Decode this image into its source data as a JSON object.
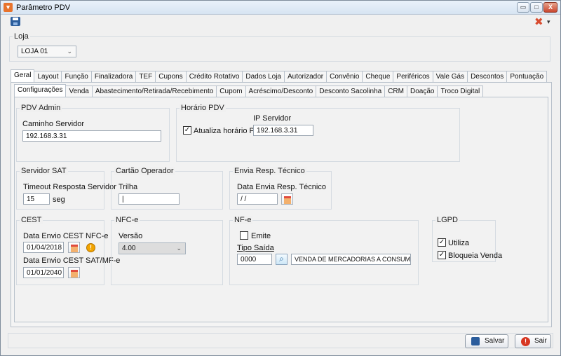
{
  "window": {
    "title": "Parâmetro PDV",
    "minimize": "▭",
    "restore": "□",
    "close": "X"
  },
  "toolbar": {
    "tools_arrow": "▾"
  },
  "loja": {
    "legend": "Loja",
    "selected": "LOJA 01",
    "arrow": "⌄"
  },
  "main_tabs": [
    "Geral",
    "Layout",
    "Função",
    "Finalizadora",
    "TEF",
    "Cupons",
    "Crédito Rotativo",
    "Dados Loja",
    "Autorizador",
    "Convênio",
    "Cheque",
    "Periféricos",
    "Vale Gás",
    "Descontos",
    "Pontuação"
  ],
  "sub_tabs": [
    "Configurações",
    "Venda",
    "Abastecimento/Retirada/Recebimento",
    "Cupom",
    "Acréscimo/Desconto",
    "Desconto Sacolinha",
    "CRM",
    "Doação",
    "Troco Digital"
  ],
  "pdv_admin": {
    "legend": "PDV Admin",
    "label": "Caminho Servidor",
    "value": "192.168.3.31"
  },
  "horario_pdv": {
    "legend": "Horário PDV",
    "ip_label": "IP Servidor",
    "checkbox_label": "Atualiza horário PDV",
    "checked_mark": "✓",
    "ip_value": "192.168.3.31"
  },
  "servidor_sat": {
    "legend": "Servidor SAT",
    "label": "Timeout Resposta Servidor",
    "value": "15",
    "unit": "seg"
  },
  "cartao_operador": {
    "legend": "Cartão Operador",
    "label": "Trilha",
    "value": "|"
  },
  "envia_resp": {
    "legend": "Envia Resp. Técnico",
    "label": "Data Envia Resp. Técnico",
    "value": " / /"
  },
  "cest": {
    "legend": "CEST",
    "nfce_label": "Data Envio CEST NFC-e",
    "nfce_value": "01/04/2018",
    "sat_label": "Data Envio CEST SAT/MF-e",
    "sat_value": "01/01/2040",
    "info_glyph": "!"
  },
  "nfce": {
    "legend": "NFC-e",
    "version_label": "Versão",
    "version_value": "4.00",
    "arrow": "⌄"
  },
  "nfe": {
    "legend": "NF-e",
    "emite_label": "Emite",
    "tipo_label": "Tipo Saída",
    "tipo_code": "0000",
    "tipo_desc": "VENDA DE MERCADORIAS A CONSUMIDOR F",
    "search_glyph": "⌕"
  },
  "lgpd": {
    "legend": "LGPD",
    "utiliza_label": "Utiliza",
    "bloqueia_label": "Bloqueia Venda",
    "checked_mark": "✓"
  },
  "buttons": {
    "save": "Salvar",
    "exit": "Sair",
    "exit_glyph": "!"
  }
}
